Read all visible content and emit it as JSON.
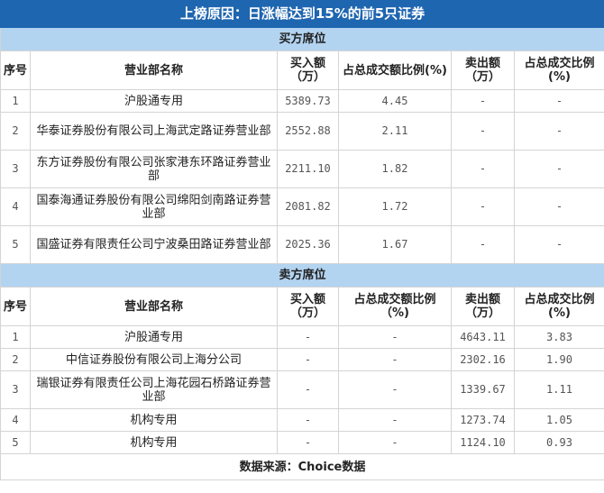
{
  "title": "上榜原因：日涨幅达到15%的前5只证券",
  "buy": {
    "section": "买方席位",
    "headers": [
      "序号",
      "营业部名称",
      "买入额（万）",
      "占总成交额比例(%)",
      "卖出额（万）",
      "占总成交比例(%)"
    ],
    "rows": [
      {
        "no": "1",
        "name": "沪股通专用",
        "buy": "5389.73",
        "buy_pct": "4.45",
        "sell": "-",
        "sell_pct": "-"
      },
      {
        "no": "2",
        "name": "华泰证券股份有限公司上海武定路证券营业部",
        "buy": "2552.88",
        "buy_pct": "2.11",
        "sell": "-",
        "sell_pct": "-"
      },
      {
        "no": "3",
        "name": "东方证券股份有限公司张家港东环路证券营业部",
        "buy": "2211.10",
        "buy_pct": "1.82",
        "sell": "-",
        "sell_pct": "-"
      },
      {
        "no": "4",
        "name": "国泰海通证券股份有限公司绵阳剑南路证券营业部",
        "buy": "2081.82",
        "buy_pct": "1.72",
        "sell": "-",
        "sell_pct": "-"
      },
      {
        "no": "5",
        "name": "国盛证券有限责任公司宁波桑田路证券营业部",
        "buy": "2025.36",
        "buy_pct": "1.67",
        "sell": "-",
        "sell_pct": "-"
      }
    ]
  },
  "sell": {
    "section": "卖方席位",
    "headers": [
      "序号",
      "营业部名称",
      "买入额（万）",
      "占总成交额比例（%)",
      "卖出额（万）",
      "占总成交比例(%)"
    ],
    "rows": [
      {
        "no": "1",
        "name": "沪股通专用",
        "buy": "-",
        "buy_pct": "-",
        "sell": "4643.11",
        "sell_pct": "3.83"
      },
      {
        "no": "2",
        "name": "中信证券股份有限公司上海分公司",
        "buy": "-",
        "buy_pct": "-",
        "sell": "2302.16",
        "sell_pct": "1.90"
      },
      {
        "no": "3",
        "name": "瑞银证券有限责任公司上海花园石桥路证券营业部",
        "buy": "-",
        "buy_pct": "-",
        "sell": "1339.67",
        "sell_pct": "1.11"
      },
      {
        "no": "4",
        "name": "机构专用",
        "buy": "-",
        "buy_pct": "-",
        "sell": "1273.74",
        "sell_pct": "1.05"
      },
      {
        "no": "5",
        "name": "机构专用",
        "buy": "-",
        "buy_pct": "-",
        "sell": "1124.10",
        "sell_pct": "0.93"
      }
    ]
  },
  "footer": "数据来源：Choice数据"
}
